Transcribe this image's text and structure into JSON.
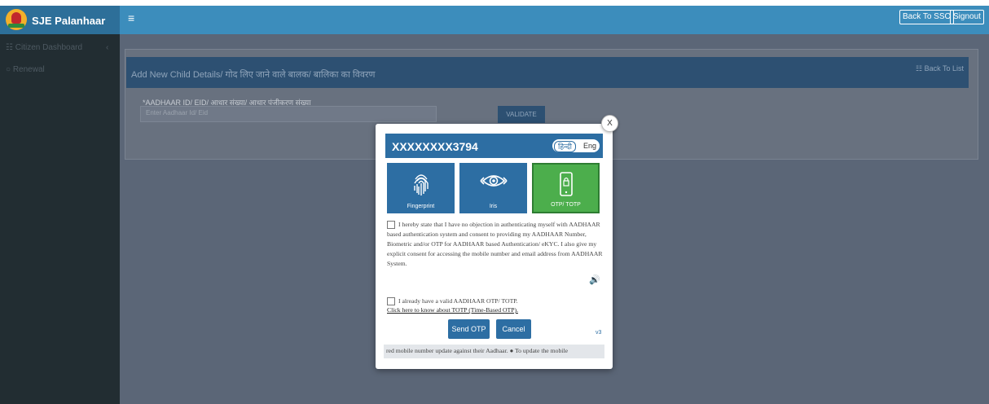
{
  "header": {
    "brand": "SJE Palanhaar",
    "menu_icon": "≡",
    "back_to_sso": "Back To SSO",
    "signout": "Signout"
  },
  "sidebar": {
    "items": [
      {
        "label": "Citizen Dashboard",
        "icon": "list-icon"
      },
      {
        "label": "Renewal",
        "icon": "circle-icon"
      }
    ]
  },
  "panel": {
    "title": "Add New Child Details/ गोद लिए जाने वाले बालक/ बालिका का विवरण",
    "back_to_list": "Back To List",
    "aadhaar_label": "*AADHAAR ID/ EID/ आधार संख्या/ आधार पंजीकरण संख्या",
    "aadhaar_placeholder": "Enter Aadhaar Id/ Eid",
    "validate": "VALIDATE"
  },
  "modal": {
    "close": "X",
    "masked_aadhaar": "XXXXXXXX3794",
    "lang_hindi": "हिन्दी",
    "lang_english": "Eng",
    "options": [
      {
        "label": "Fingerprint",
        "icon": "fingerprint-icon",
        "active": false
      },
      {
        "label": "Iris",
        "icon": "eye-icon",
        "active": false
      },
      {
        "label": "OTP/ TOTP",
        "icon": "mobile-lock-icon",
        "active": true
      }
    ],
    "consent_text": "I hereby state that I have no objection in authenticating myself with AADHAAR based authentication system and consent to providing my AADHAAR Number, Biometric and/or OTP for AADHAAR based Authentication/ eKYC. I also give my explicit consent for accessing the mobile number and email address from AADHAAR System.",
    "have_otp": "I already have a valid AADHAAR OTP/ TOTP.",
    "totp_link": "Click here to know about TOTP (Time-Based OTP).",
    "send_otp": "Send OTP",
    "cancel": "Cancel",
    "version": "v3",
    "ticker": "red mobile number update against their Aadhaar. ● To update the mobile"
  },
  "colors": {
    "header_blue": "#3c8dbc",
    "brand_blue": "#2d6f99",
    "sidebar_dark": "#222d32",
    "modal_blue": "#2d6ea3",
    "active_green": "#4cae4c"
  }
}
